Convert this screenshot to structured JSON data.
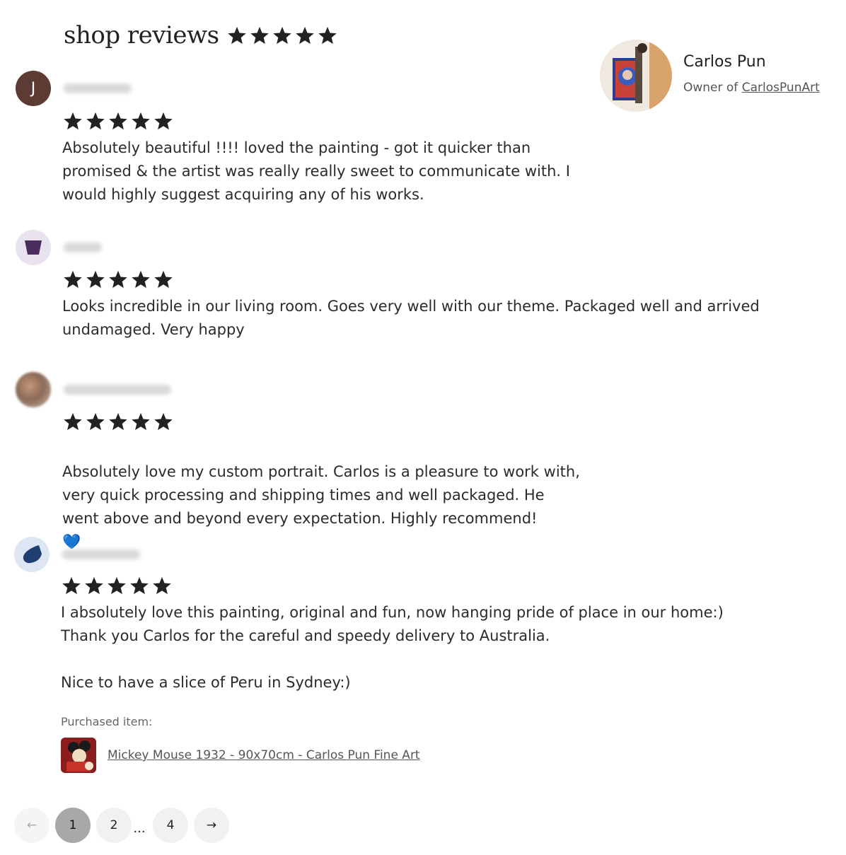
{
  "header": {
    "title": "shop reviews",
    "rating_stars": 5
  },
  "owner": {
    "name": "Carlos Pun",
    "role_prefix": "Owner of",
    "shop_name": "CarlosPunArt"
  },
  "reviews": [
    {
      "avatar_letter": "J",
      "stars": 5,
      "text": "Absolutely beautiful !!!! loved the painting - got it quicker than\npromised & the artist was really really sweet to communicate with. I\nwould highly suggest acquiring any of his works."
    },
    {
      "stars": 5,
      "text": "Looks incredible in our living room. Goes very well with our theme. Packaged well and arrived\nundamaged. Very happy"
    },
    {
      "stars": 5,
      "text": "Absolutely love my custom portrait. Carlos is a pleasure to work with,\nvery quick processing and shipping times and well packaged. He\nwent above and beyond every expectation. Highly recommend!",
      "emoji": "💙"
    },
    {
      "stars": 5,
      "text": "I absolutely love this painting, original and fun, now hanging pride of place in our home:)\nThank you Carlos for the careful and speedy delivery to Australia.\n\nNice to have a slice of Peru in Sydney:)"
    }
  ],
  "purchased": {
    "label": "Purchased item:",
    "item_title": "Mickey Mouse 1932 - 90x70cm - Carlos Pun Fine Art"
  },
  "pagination": {
    "prev": "←",
    "pages": [
      "1",
      "2",
      "4"
    ],
    "ellipsis": "...",
    "next": "→",
    "current": "1"
  },
  "colors": {
    "star": "#222222",
    "avatar_letter_bg": "#5c3b35",
    "purple_icon": "#4a2c5e",
    "blue_icon": "#1f3f72",
    "heart": "#2f8ff0",
    "active_page_bg": "#a8a8a8"
  }
}
